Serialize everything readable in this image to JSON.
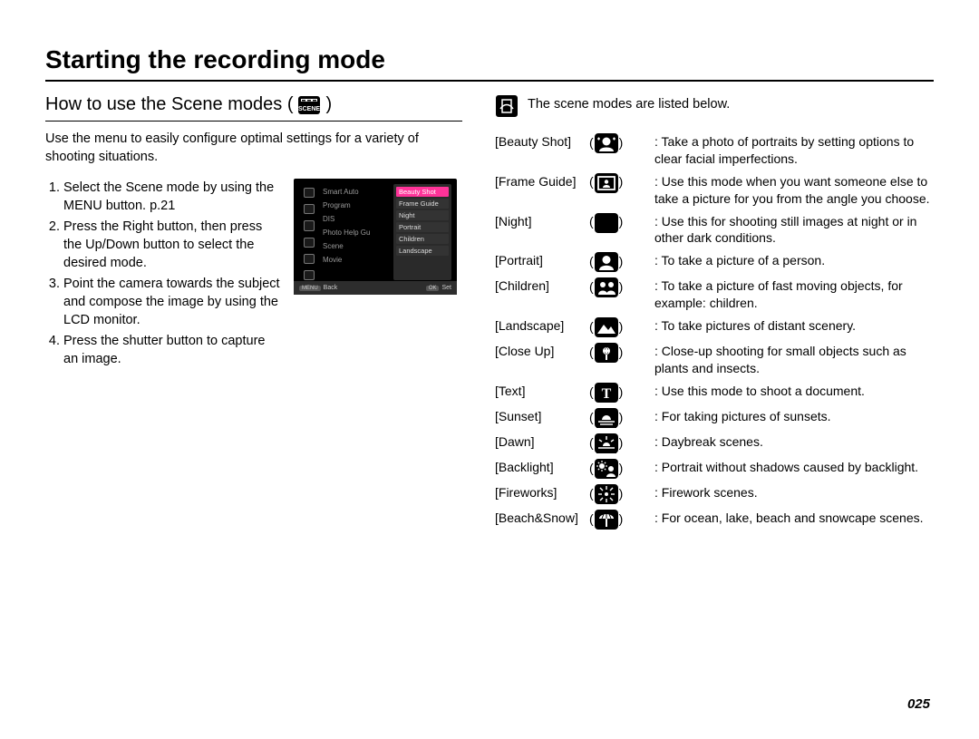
{
  "title": "Starting the recording mode",
  "subtitle": "How to use the Scene modes (",
  "subtitle_close": ")",
  "intro": "Use the menu to easily configure optimal settings for a variety of shooting situations.",
  "steps": [
    "Select the Scene mode by using the MENU button. p.21",
    "Press the Right button, then press the Up/Down button to select the desired mode.",
    "Point the camera towards the subject and compose the image by using the LCD monitor.",
    "Press the shutter button to capture an image."
  ],
  "lcd": {
    "mid_rows": [
      "Smart Auto",
      "Program",
      "DIS",
      "Photo Help Gu",
      "Scene",
      "Movie"
    ],
    "right_items": [
      "Beauty Shot",
      "Frame Guide",
      "Night",
      "Portrait",
      "Children",
      "Landscape"
    ],
    "right_selected_index": 0,
    "footer": {
      "left_key": "MENU",
      "left_label": "Back",
      "right_key": "OK",
      "right_label": "Set"
    }
  },
  "note_text": "The scene modes are listed below.",
  "modes": [
    {
      "name": "[Beauty Shot]",
      "icon": "beauty",
      "desc": ": Take a photo of portraits by setting options to clear facial imperfections."
    },
    {
      "name": "[Frame Guide]",
      "icon": "frameguide",
      "desc": ": Use this mode when you want someone else to take a picture for you from the angle you choose."
    },
    {
      "name": "[Night]",
      "icon": "night",
      "desc": ": Use this for shooting still images at night or in other dark conditions."
    },
    {
      "name": "[Portrait]",
      "icon": "portrait",
      "desc": ": To take a picture of a person."
    },
    {
      "name": "[Children]",
      "icon": "children",
      "desc": ": To take a picture of fast moving objects, for example: children."
    },
    {
      "name": "[Landscape]",
      "icon": "landscape",
      "desc": ": To take pictures of distant scenery."
    },
    {
      "name": "[Close Up]",
      "icon": "closeup",
      "desc": ": Close-up shooting for small objects such as plants and insects."
    },
    {
      "name": "[Text]",
      "icon": "text",
      "desc": ": Use this mode to shoot a document."
    },
    {
      "name": "[Sunset]",
      "icon": "sunset",
      "desc": ": For taking pictures of sunsets."
    },
    {
      "name": "[Dawn]",
      "icon": "dawn",
      "desc": ": Daybreak scenes."
    },
    {
      "name": "[Backlight]",
      "icon": "backlight",
      "desc": ": Portrait without shadows caused by backlight."
    },
    {
      "name": "[Fireworks]",
      "icon": "fireworks",
      "desc": ": Firework scenes."
    },
    {
      "name": "[Beach&Snow]",
      "icon": "beachsnow",
      "desc": ": For ocean, lake, beach and snowcape scenes."
    }
  ],
  "page_number": "025"
}
